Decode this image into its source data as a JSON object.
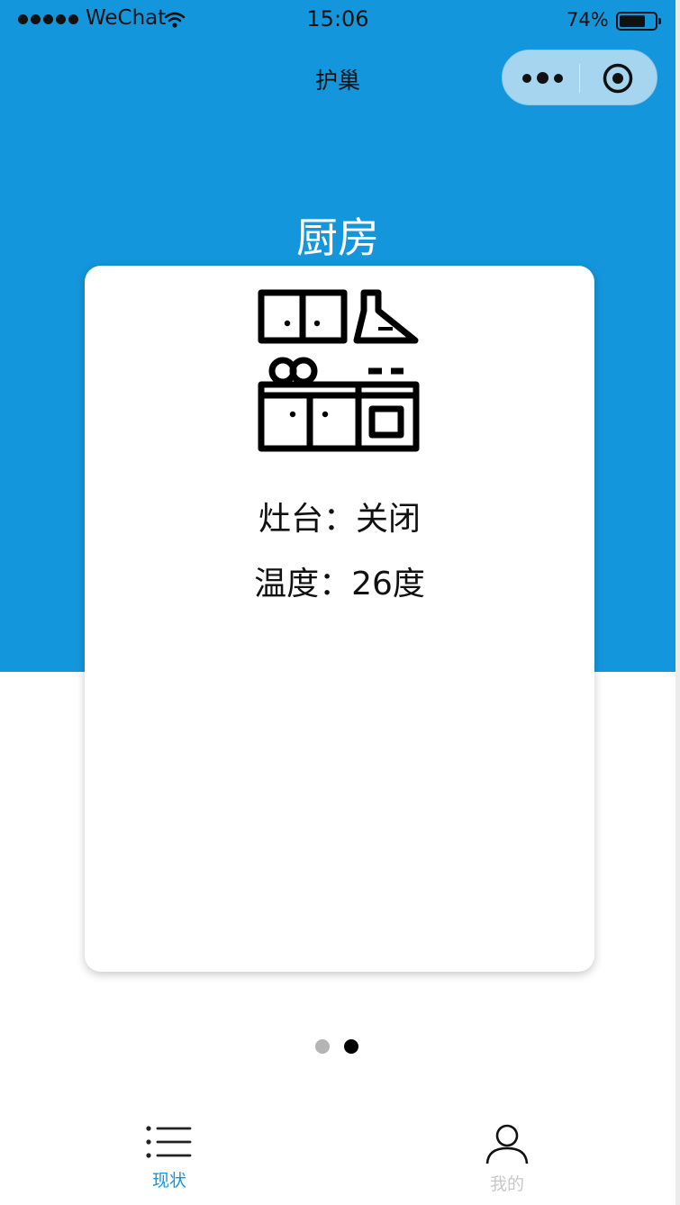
{
  "status_bar": {
    "carrier": "WeChat",
    "time": "15:06",
    "battery_pct": "74%",
    "battery_level": 0.74
  },
  "nav": {
    "title": "护巢",
    "capsule_icons": [
      "more-icon",
      "target-icon"
    ]
  },
  "carousel": {
    "room_title": "厨房",
    "room_icon": "kitchen-icon",
    "stove_label": "灶台：",
    "stove_value": "关闭",
    "temp_label": "温度：",
    "temp_value": "26度",
    "page_count": 2,
    "active_page": 2
  },
  "tabbar": {
    "items": [
      {
        "label": "现状",
        "icon": "list-icon",
        "active": true
      },
      {
        "label": "我的",
        "icon": "user-icon",
        "active": false
      }
    ]
  },
  "colors": {
    "primary": "#1496dc",
    "capsule": "#a6d5f0",
    "tab_active": "#1496dc",
    "tab_inactive": "#c8c8c8",
    "dot_active": "#000000",
    "dot_inactive": "#b4b4b4"
  }
}
